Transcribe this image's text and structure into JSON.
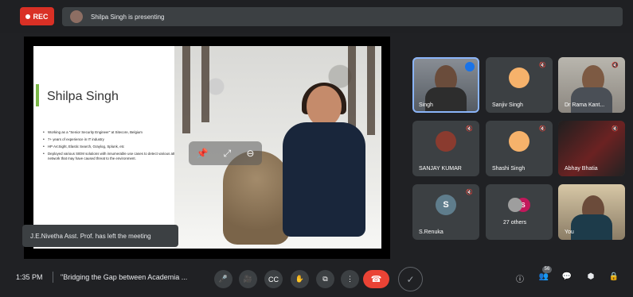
{
  "top_bar": {
    "rec_label": "REC",
    "presenting_text": "Shilpa Singh is presenting"
  },
  "slide": {
    "title": "Shilpa Singh",
    "bullets": [
      "Working as a \"Senior Security Engineer\" at Sitecore, Belgium",
      "7+ years of experience in IT industry",
      "HP ArcSight, Elastic Search, Graylog, Splunk, etc",
      "Deployed various SIEM solutions with innumerable use cases to detect various attacks across network that may have caused threat to the environment."
    ]
  },
  "toast": {
    "message": "J.E.Nivetha Asst. Prof. has left the meeting"
  },
  "participants": [
    {
      "name": "Singh",
      "type": "video"
    },
    {
      "name": "Sanjiv Singh",
      "type": "avatar"
    },
    {
      "name": "Dr Rama Kant...",
      "type": "video"
    },
    {
      "name": "SANJAY KUMAR",
      "type": "avatar"
    },
    {
      "name": "Shashi Singh",
      "type": "avatar"
    },
    {
      "name": "Abhay Bhatia",
      "type": "video"
    },
    {
      "name": "S.Renuka",
      "type": "avatar",
      "initial": "S"
    },
    {
      "name": "27 others",
      "type": "group",
      "initial": "S"
    },
    {
      "name": "You",
      "type": "video"
    }
  ],
  "bottom_bar": {
    "time": "1:35 PM",
    "meeting_title": "\"Bridging the Gap between Academia ...",
    "participant_count": "56"
  },
  "colors": {
    "accent": "#1a73e8",
    "rec": "#d93025",
    "leave": "#ea4335",
    "tile": "#3c4043",
    "bg": "#202124"
  },
  "icons": {
    "mic": "microphone-icon",
    "camera": "camera-icon",
    "captions": "captions-icon",
    "raise_hand": "raise-hand-icon",
    "present": "present-icon",
    "more": "more-options-icon",
    "leave": "phone-hangup-icon",
    "info": "info-icon",
    "people": "people-icon",
    "chat": "chat-icon",
    "activities": "activities-icon",
    "security": "security-icon"
  }
}
